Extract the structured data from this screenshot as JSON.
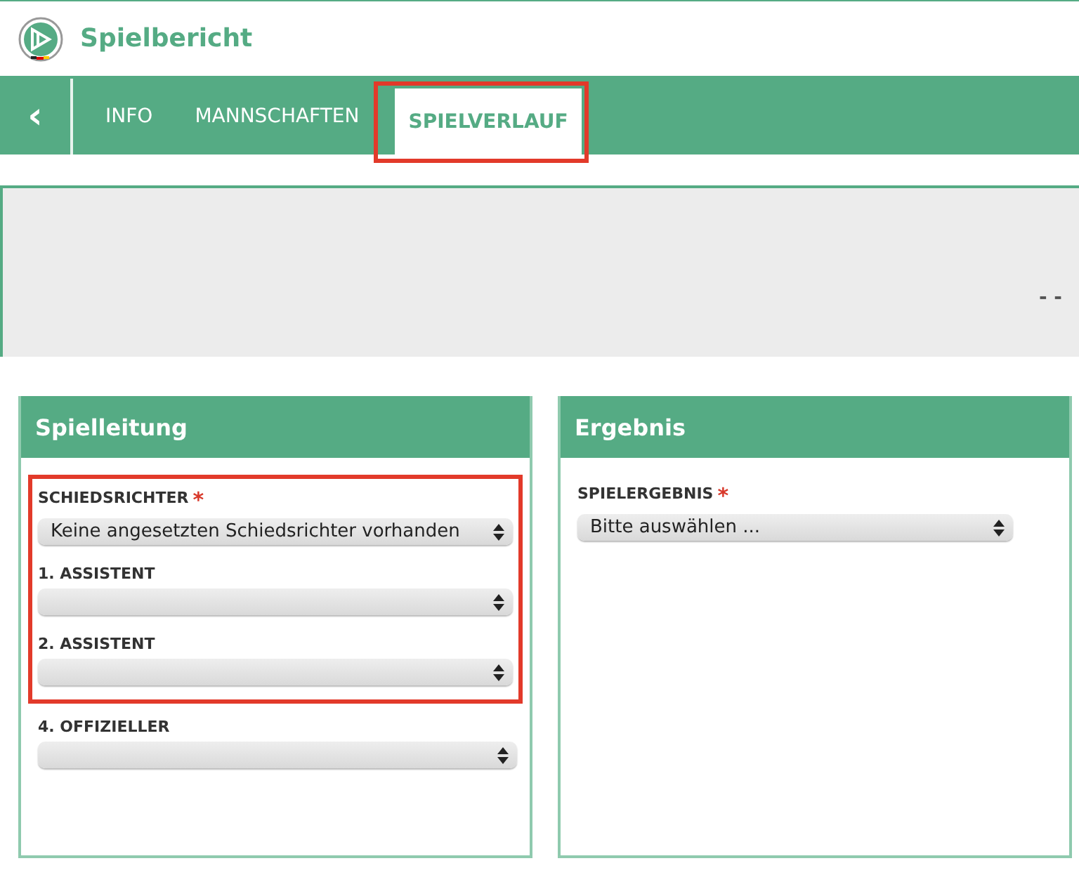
{
  "header": {
    "title": "Spielbericht"
  },
  "nav": {
    "back": "‹",
    "tabs": [
      {
        "label": "INFO",
        "selected": false,
        "highlighted": false
      },
      {
        "label": "MANNSCHAFTEN",
        "selected": false,
        "highlighted": false
      },
      {
        "label": "SPIELVERLAUF",
        "selected": true,
        "highlighted": true
      }
    ]
  },
  "score": "- -",
  "panels": [
    {
      "title": "Spielleitung",
      "fields": [
        {
          "label": "SCHIEDSRICHTER",
          "required_mark": "*",
          "value": "Keine angesetzten Schiedsrichter vorhanden",
          "highlighted": true
        },
        {
          "label": "1. ASSISTENT",
          "highlighted": true
        },
        {
          "label": "2. ASSISTENT",
          "highlighted": true
        },
        {
          "label": "4. OFFIZIELLER",
          "highlighted": false
        }
      ]
    },
    {
      "title": "Ergebnis",
      "fields": [
        {
          "label": "SPIELERGEBNIS",
          "required_mark": "*",
          "value": "Bitte auswählen ...",
          "highlighted": false
        }
      ]
    }
  ]
}
